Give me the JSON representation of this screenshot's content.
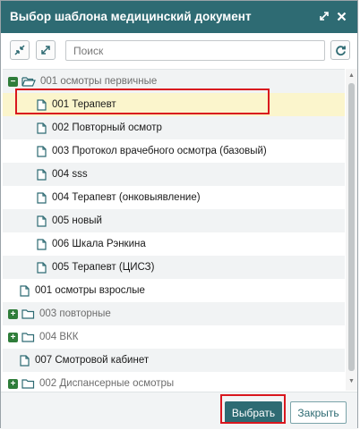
{
  "dialog": {
    "title": "Выбор шаблона медицинский документ"
  },
  "toolbar": {
    "search_placeholder": "Поиск"
  },
  "tree": [
    {
      "label": "001 осмотры первичные",
      "kind": "group-open",
      "level": 0,
      "toggle": "−"
    },
    {
      "label": "001 Терапевт",
      "kind": "doc",
      "level": 1,
      "selected": true
    },
    {
      "label": "002 Повторный осмотр",
      "kind": "doc",
      "level": 1
    },
    {
      "label": "003 Протокол врачебного осмотра (базовый)",
      "kind": "doc",
      "level": 1
    },
    {
      "label": "004 sss",
      "kind": "doc",
      "level": 1
    },
    {
      "label": "004 Терапевт (онковыявление)",
      "kind": "doc",
      "level": 1
    },
    {
      "label": "005 новый",
      "kind": "doc",
      "level": 1
    },
    {
      "label": "006 Шкала Рэнкина",
      "kind": "doc",
      "level": 1
    },
    {
      "label": "005 Терапевт (ЦИСЗ)",
      "kind": "doc",
      "level": 1
    },
    {
      "label": "001 осмотры взрослые",
      "kind": "doc",
      "level": 0
    },
    {
      "label": "003 повторные",
      "kind": "group-closed",
      "level": 0,
      "toggle": "+"
    },
    {
      "label": "004 ВКК",
      "kind": "group-closed",
      "level": 0,
      "toggle": "+"
    },
    {
      "label": "007 Смотровой кабинет",
      "kind": "doc",
      "level": 0
    },
    {
      "label": "002 Диспансерные осмотры",
      "kind": "group-closed",
      "level": 0,
      "toggle": "+"
    }
  ],
  "footer": {
    "select_label": "Выбрать",
    "close_label": "Закрыть"
  },
  "colors": {
    "header": "#2e6b73",
    "selected_row": "#fbf5cc",
    "highlight": "#d9171e",
    "toggle": "#2f7d3a"
  }
}
